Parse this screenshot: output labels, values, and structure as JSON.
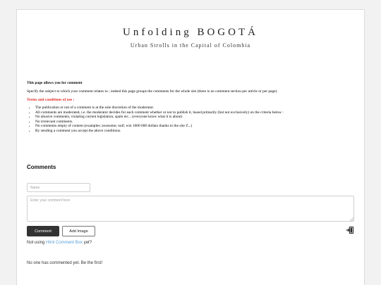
{
  "site": {
    "title": "Unfolding BOGOTÁ",
    "subtitle": "Urban Strolls in the Capital of Colombia"
  },
  "info": {
    "heading": "This page allows you for comment",
    "specify": "Specify the subject to which your comment relates to ; indeed this page groups the comments for the whole site (there is no comment section per article or per page).",
    "terms_title": "Terms and conditions of use :",
    "rules": [
      "The publication or not of a comment is at the sole discretion of the moderator.",
      "All comments are moderated, i.e. the moderator decides for each comment whether or not to publish it, based primarily (but not exclusively) on the criteria below :",
      "No abusive comments, violating current legislation, spam etc... (everyone know what it is about)",
      "No irrelevant comments.",
      "No comments empty of content (examples: awesome; null; win 1000 000 dollars thanks to the site Z...)",
      "By sending a comment you accept the above conditions."
    ]
  },
  "comments": {
    "title": "Comments",
    "name_placeholder": "Name",
    "comment_placeholder": "Enter your comment here",
    "comment_button": "Comment",
    "add_image_button": "Add Image",
    "not_using_prefix": "Not using",
    "not_using_link": "Html Comment Box",
    "not_using_suffix": "yet?",
    "empty_message": "No one has commented yet. Be the first!"
  },
  "icons": {
    "login": "login-door-icon",
    "resize": "resize-grip-icon"
  },
  "colors": {
    "terms_red": "#e02020",
    "link_blue": "#5aa0d8",
    "button_dark": "#333333"
  }
}
